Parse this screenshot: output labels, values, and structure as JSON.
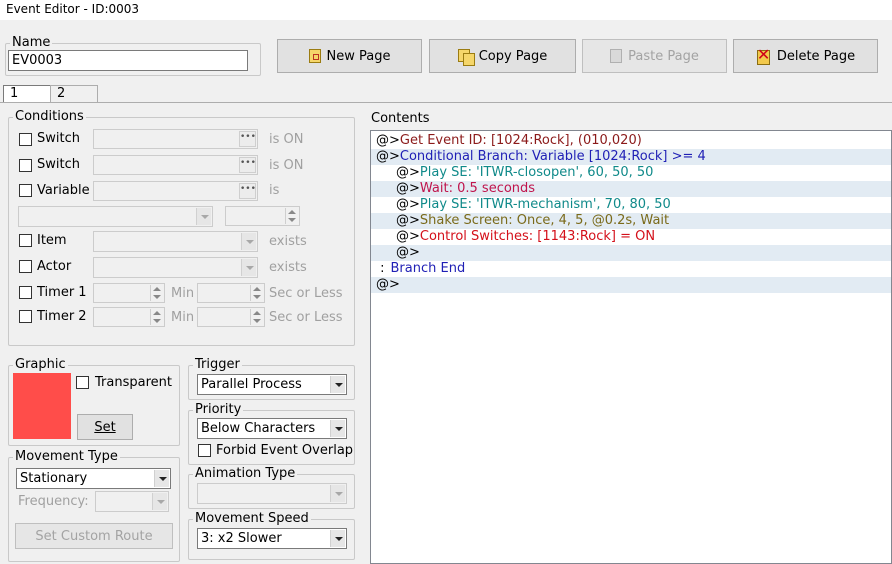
{
  "window": {
    "title": "Event Editor - ID:0003"
  },
  "name_group": {
    "legend": "Name",
    "value": "EV0003"
  },
  "toolbar": {
    "new_page": "New Page",
    "copy_page": "Copy Page",
    "paste_page": "Paste Page",
    "delete_page": "Delete Page"
  },
  "tabs": [
    "1",
    "2"
  ],
  "conditions": {
    "legend": "Conditions",
    "switch1": {
      "label": "Switch",
      "suffix": "is ON"
    },
    "switch2": {
      "label": "Switch",
      "suffix": "is ON"
    },
    "variable": {
      "label": "Variable",
      "suffix": "is"
    },
    "item": {
      "label": "Item",
      "suffix": "exists"
    },
    "actor": {
      "label": "Actor",
      "suffix": "exists"
    },
    "timer1": {
      "label": "Timer 1",
      "min": "Min",
      "suffix": "Sec or Less"
    },
    "timer2": {
      "label": "Timer 2",
      "min": "Min",
      "suffix": "Sec or Less"
    }
  },
  "graphic": {
    "legend": "Graphic",
    "transparent": "Transparent",
    "set": "Set",
    "color": "#ff4d4a"
  },
  "trigger": {
    "legend": "Trigger",
    "value": "Parallel Process"
  },
  "priority": {
    "legend": "Priority",
    "value": "Below Characters",
    "forbid": "Forbid Event Overlap"
  },
  "movement_type": {
    "legend": "Movement Type",
    "value": "Stationary",
    "frequency": "Frequency:",
    "custom_route": "Set Custom Route"
  },
  "animation_type": {
    "legend": "Animation Type"
  },
  "movement_speed": {
    "legend": "Movement Speed",
    "value": "3: x2 Slower"
  },
  "contents": {
    "legend": "Contents",
    "lines": [
      {
        "prefix": "@>",
        "text": "Get Event ID: [1024:Rock], (010,020)",
        "color": "#8b1a1a",
        "indent": 0,
        "alt": false
      },
      {
        "prefix": "@>",
        "text": "Conditional Branch: Variable [1024:Rock] >= 4",
        "color": "#1f1fb5",
        "indent": 0,
        "alt": true
      },
      {
        "prefix": "@>",
        "text": "Play SE: 'ITWR-closopen', 60, 50, 50",
        "color": "#108a8a",
        "indent": 1,
        "alt": false
      },
      {
        "prefix": "@>",
        "text": "Wait: 0.5 seconds",
        "color": "#c0144c",
        "indent": 1,
        "alt": true
      },
      {
        "prefix": "@>",
        "text": "Play SE: 'ITWR-mechanism', 70, 80, 50",
        "color": "#108a8a",
        "indent": 1,
        "alt": false
      },
      {
        "prefix": "@>",
        "text": "Shake Screen: Once, 4, 5, @0.2s, Wait",
        "color": "#7a6a1a",
        "indent": 1,
        "alt": true
      },
      {
        "prefix": "@>",
        "text": "Control Switches: [1143:Rock] = ON",
        "color": "#d4101a",
        "indent": 1,
        "alt": false
      },
      {
        "prefix": "@>",
        "text": "",
        "color": "#000000",
        "indent": 1,
        "alt": true
      },
      {
        "prefix": " :",
        "text": "Branch End",
        "color": "#1f1fb5",
        "indent": 0,
        "alt": false
      },
      {
        "prefix": "@>",
        "text": "",
        "color": "#000000",
        "indent": 0,
        "alt": true
      }
    ]
  }
}
